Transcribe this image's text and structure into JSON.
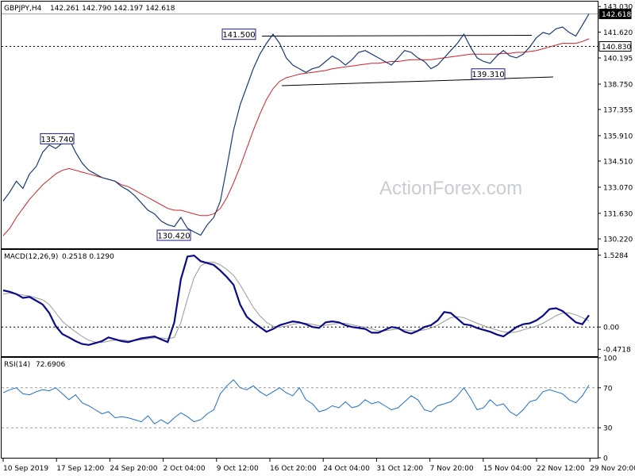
{
  "header": {
    "price_title": "GBPJPY,H4",
    "ohlc": "142.261 142.790 142.197 142.618",
    "macd_title": "MACD(12,26,9)",
    "macd_values": "0.2518 0.1290",
    "rsi_title": "RSI(14)",
    "rsi_value": "72.6906"
  },
  "watermark": "ActionForex.com",
  "colors": {
    "price": "#1a3a78",
    "ma": "#d0202a",
    "macd": "#0a0a8a",
    "signal": "#9a9a9a",
    "rsi": "#1e6fcf",
    "grid": "#9a9a9a"
  },
  "chart_data": [
    {
      "type": "line",
      "panel": "price",
      "ylim": [
        129.7,
        143.3
      ],
      "yticks": [
        "143.030",
        "141.620",
        "140.195",
        "138.750",
        "137.355",
        "135.910",
        "134.510",
        "133.070",
        "131.630",
        "130.220"
      ],
      "ytick_values": [
        143.03,
        141.62,
        140.195,
        138.75,
        137.355,
        135.91,
        134.51,
        133.07,
        131.63,
        130.22
      ],
      "xticks": [
        "10 Sep 2019",
        "17 Sep 12:00",
        "24 Sep 20:00",
        "2 Oct 04:00",
        "9 Oct 12:00",
        "16 Oct 20:00",
        "24 Oct 04:00",
        "31 Oct 12:00",
        "7 Nov 20:00",
        "15 Nov 04:00",
        "22 Nov 12:00",
        "29 Nov 20:00"
      ],
      "current_price": {
        "label": "142.618",
        "value": 142.618
      },
      "reference_level": {
        "label": "140.830",
        "value": 140.83
      },
      "annotations": [
        {
          "text": "135.740",
          "value": 135.74
        },
        {
          "text": "130.420",
          "value": 130.42
        },
        {
          "text": "141.500",
          "value": 141.5
        },
        {
          "text": "139.310",
          "value": 139.31
        }
      ],
      "series": [
        {
          "values": [
            132.3,
            132.8,
            133.4,
            133.0,
            133.8,
            134.2,
            135.0,
            135.4,
            135.2,
            135.5,
            135.74,
            135.0,
            134.4,
            134.0,
            133.8,
            133.6,
            133.5,
            133.4,
            133.1,
            132.9,
            132.6,
            132.2,
            131.8,
            131.6,
            131.2,
            131.0,
            130.9,
            131.4,
            130.8,
            130.6,
            130.42,
            131.0,
            131.4,
            132.3,
            134.2,
            136.2,
            137.6,
            138.6,
            139.6,
            140.4,
            141.0,
            141.5,
            141.0,
            140.2,
            139.8,
            139.6,
            139.4,
            139.6,
            139.7,
            140.0,
            140.3,
            140.1,
            139.8,
            140.1,
            140.5,
            140.6,
            140.4,
            140.2,
            140.0,
            139.8,
            140.2,
            140.6,
            140.5,
            140.2,
            140.0,
            139.6,
            139.8,
            140.2,
            140.6,
            141.0,
            141.5,
            140.8,
            140.2,
            140.0,
            139.9,
            140.3,
            140.6,
            140.3,
            140.2,
            140.4,
            140.8,
            141.3,
            141.6,
            141.5,
            141.8,
            141.9,
            141.6,
            141.4,
            142.0,
            142.618
          ]
        },
        {
          "name": "MA",
          "values": [
            130.4,
            130.8,
            131.4,
            131.9,
            132.4,
            132.8,
            133.2,
            133.5,
            133.8,
            134.0,
            134.1,
            134.0,
            133.9,
            133.8,
            133.7,
            133.6,
            133.5,
            133.4,
            133.2,
            133.1,
            132.9,
            132.7,
            132.5,
            132.3,
            132.1,
            131.9,
            131.8,
            131.8,
            131.7,
            131.6,
            131.5,
            131.5,
            131.6,
            131.9,
            132.5,
            133.3,
            134.2,
            135.2,
            136.2,
            137.1,
            137.9,
            138.5,
            138.9,
            139.1,
            139.2,
            139.3,
            139.35,
            139.4,
            139.45,
            139.5,
            139.6,
            139.65,
            139.7,
            139.75,
            139.8,
            139.85,
            139.9,
            139.9,
            139.95,
            140.0,
            140.0,
            140.05,
            140.1,
            140.1,
            140.1,
            140.1,
            140.15,
            140.2,
            140.25,
            140.3,
            140.35,
            140.4,
            140.4,
            140.4,
            140.4,
            140.4,
            140.45,
            140.45,
            140.5,
            140.5,
            140.55,
            140.6,
            140.7,
            140.8,
            140.9,
            141.0,
            141.0,
            141.0,
            141.1,
            141.25
          ]
        }
      ]
    },
    {
      "type": "line",
      "panel": "macd",
      "ylim": [
        -0.62,
        1.64
      ],
      "yticks": [
        "1.5284",
        "0.00",
        "-0.4718"
      ],
      "ytick_values": [
        1.5284,
        0.0,
        -0.4718
      ],
      "zero_label": "0.00",
      "series": [
        {
          "name": "MACD",
          "values": [
            0.78,
            0.75,
            0.7,
            0.62,
            0.64,
            0.56,
            0.48,
            0.3,
            0.02,
            -0.15,
            -0.22,
            -0.3,
            -0.36,
            -0.38,
            -0.34,
            -0.3,
            -0.22,
            -0.26,
            -0.3,
            -0.32,
            -0.28,
            -0.24,
            -0.22,
            -0.2,
            -0.26,
            -0.32,
            0.1,
            1.02,
            1.5,
            1.52,
            1.4,
            1.36,
            1.32,
            1.2,
            1.06,
            0.9,
            0.48,
            0.22,
            0.1,
            0.0,
            -0.1,
            -0.04,
            0.04,
            0.08,
            0.12,
            0.1,
            0.06,
            0.0,
            -0.02,
            0.1,
            0.12,
            0.1,
            0.04,
            0.0,
            -0.02,
            -0.04,
            -0.12,
            -0.12,
            -0.06,
            0.0,
            -0.02,
            -0.1,
            -0.14,
            -0.08,
            0.0,
            0.04,
            0.14,
            0.32,
            0.3,
            0.18,
            0.06,
            0.04,
            -0.02,
            -0.06,
            -0.1,
            -0.16,
            -0.2,
            -0.1,
            0.0,
            0.06,
            0.08,
            0.14,
            0.24,
            0.38,
            0.4,
            0.34,
            0.22,
            0.1,
            0.06,
            0.25
          ]
        },
        {
          "name": "Signal",
          "values": [
            0.7,
            0.72,
            0.7,
            0.68,
            0.66,
            0.62,
            0.58,
            0.48,
            0.3,
            0.12,
            0.0,
            -0.1,
            -0.2,
            -0.28,
            -0.32,
            -0.33,
            -0.3,
            -0.28,
            -0.27,
            -0.29,
            -0.29,
            -0.27,
            -0.25,
            -0.23,
            -0.23,
            -0.25,
            -0.22,
            0.1,
            0.6,
            1.05,
            1.3,
            1.38,
            1.38,
            1.32,
            1.22,
            1.1,
            0.9,
            0.66,
            0.42,
            0.24,
            0.1,
            0.02,
            0.0,
            0.02,
            0.06,
            0.08,
            0.08,
            0.06,
            0.03,
            0.04,
            0.06,
            0.08,
            0.08,
            0.05,
            0.02,
            0.0,
            -0.04,
            -0.08,
            -0.08,
            -0.06,
            -0.04,
            -0.06,
            -0.08,
            -0.08,
            -0.06,
            -0.02,
            0.04,
            0.12,
            0.2,
            0.22,
            0.2,
            0.14,
            0.08,
            0.03,
            -0.02,
            -0.06,
            -0.1,
            -0.12,
            -0.1,
            -0.06,
            -0.02,
            0.02,
            0.08,
            0.16,
            0.24,
            0.3,
            0.3,
            0.26,
            0.2,
            0.13
          ]
        }
      ]
    },
    {
      "type": "line",
      "panel": "rsi",
      "ylim": [
        0,
        100
      ],
      "yticks": [
        "100",
        "70",
        "30",
        "0"
      ],
      "ytick_values": [
        100,
        70,
        30,
        0
      ],
      "levels": [
        70,
        30
      ],
      "series": [
        {
          "name": "RSI",
          "values": [
            65,
            68,
            70,
            64,
            63,
            66,
            68,
            67,
            70,
            64,
            58,
            63,
            55,
            52,
            48,
            44,
            46,
            40,
            41,
            40,
            38,
            36,
            42,
            34,
            38,
            34,
            40,
            45,
            41,
            36,
            38,
            44,
            48,
            64,
            72,
            78,
            70,
            68,
            72,
            66,
            62,
            66,
            70,
            65,
            62,
            70,
            58,
            54,
            46,
            48,
            52,
            50,
            56,
            50,
            52,
            58,
            54,
            56,
            52,
            48,
            50,
            56,
            62,
            58,
            48,
            46,
            52,
            54,
            56,
            62,
            70,
            60,
            48,
            50,
            58,
            52,
            54,
            46,
            42,
            48,
            56,
            58,
            66,
            68,
            66,
            64,
            58,
            55,
            62,
            72.69
          ]
        }
      ]
    }
  ]
}
